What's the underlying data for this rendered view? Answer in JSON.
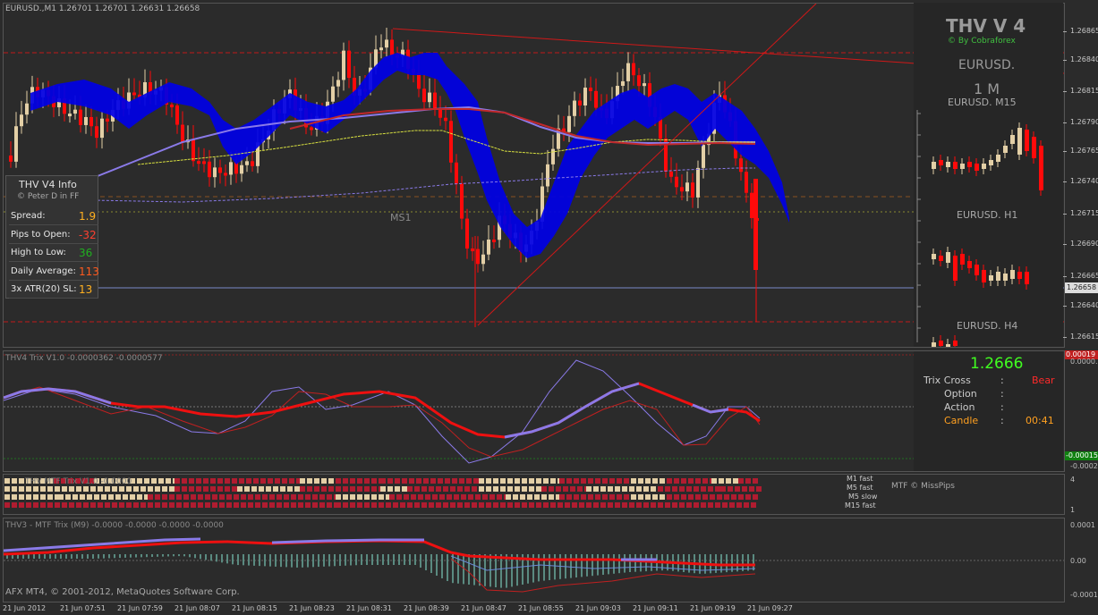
{
  "main_chart": {
    "header": "EURUSD.,M1  1.26701 1.26701 1.26631 1.26658",
    "ms1_label": "MS1",
    "price_labels": [
      "1.26865",
      "1.26840",
      "1.26815",
      "1.26790",
      "1.26765",
      "1.26740",
      "1.26715",
      "1.26690",
      "1.26665",
      "1.26658",
      "1.26640",
      "1.26615"
    ],
    "current_price_tag": "1.26658"
  },
  "info_box": {
    "title": "THV  V4  Info",
    "credit": "© Peter D in FF",
    "rows": [
      {
        "label": "Spread:",
        "value": "1.9",
        "color": "#ffb020"
      },
      {
        "label": "Pips to Open:",
        "value": "-32",
        "color": "#ff4030"
      },
      {
        "label": "High to Low:",
        "value": "36",
        "color": "#20b020"
      },
      {
        "label": "Daily Average:",
        "value": "113",
        "color": "#ff5a1e"
      },
      {
        "label": "3x ATR(20) SL:",
        "value": "13",
        "color": "#ffb020"
      }
    ]
  },
  "side_panel": {
    "title": "THV V 4",
    "subtitle": "© By Cobraforex",
    "symbol": "EURUSD.",
    "timeframe": "1 M",
    "mini_charts": [
      "EURUSD.  M15",
      "EURUSD.  H1",
      "EURUSD.  H4"
    ]
  },
  "trix_pane": {
    "header": "THV4 Trix V1.0 -0.0000362 -0.0000577",
    "axis_top": "0.0000...",
    "axis_bottom": "-0.00022",
    "top_tag": "0.00019",
    "bottom_tag": "-0.00015"
  },
  "trix_panel": {
    "price": "1.2666",
    "rows": [
      {
        "label": "Trix Cross",
        "sep": ":",
        "value": "Bear",
        "color": "#ff2a2a"
      },
      {
        "label": "Option",
        "sep": ":",
        "value": ""
      },
      {
        "label": "Action",
        "sep": ":",
        "value": ""
      },
      {
        "label": "Candle",
        "sep": ":",
        "value": "00:41",
        "color": "#ffa020"
      }
    ]
  },
  "mtf_pane": {
    "header": "THV MTF Trix V1.0 -0.0000",
    "row_labels": [
      "M1 fast",
      "M5 fast",
      "M5 slow",
      "M15 fast"
    ],
    "credit": "MTF © MissPips",
    "axis_top": "4",
    "axis_bottom": "1"
  },
  "thv3_pane": {
    "header": "THV3 - MTF Trix (M9) -0.0000 -0.0000 -0.0000 -0.0000",
    "axis": [
      "0.0001",
      "0.00",
      "-0.0001"
    ],
    "copyright": "AFX MT4, © 2001-2012, MetaQuotes Software Corp."
  },
  "time_axis": [
    "21 Jun 2012",
    "21 Jun 07:51",
    "21 Jun 07:59",
    "21 Jun 08:07",
    "21 Jun 08:15",
    "21 Jun 08:23",
    "21 Jun 08:31",
    "21 Jun 08:39",
    "21 Jun 08:47",
    "21 Jun 08:55",
    "21 Jun 09:03",
    "21 Jun 09:11",
    "21 Jun 09:19",
    "21 Jun 09:27"
  ],
  "colors": {
    "bull": "#e3cfa6",
    "bear": "#ff0a0a",
    "cloud": "#0000ee",
    "ma_purple": "#8a7ae8",
    "ma_red": "#c0282a",
    "ma_yellow": "#d8e040",
    "trend": "#d01818",
    "green_price": "#40ff20"
  }
}
